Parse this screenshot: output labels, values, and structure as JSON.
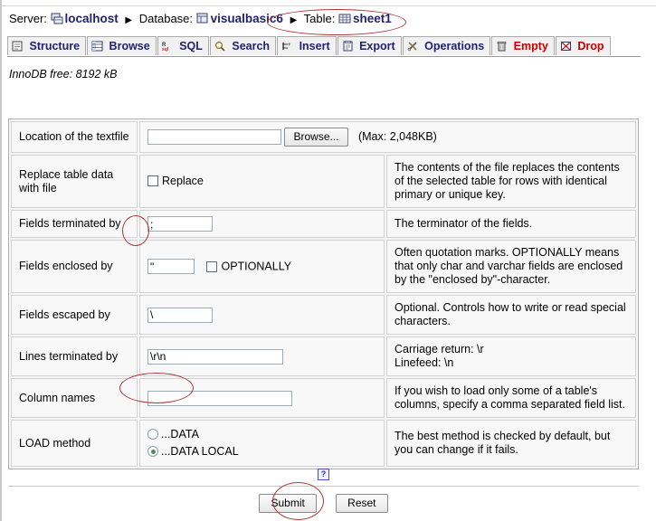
{
  "breadcrumb": {
    "server_label": "Server:",
    "server_value": "localhost",
    "database_label": "Database:",
    "database_value": "visualbasic6",
    "table_label": "Table:",
    "table_value": "sheet1",
    "separator": "▶"
  },
  "tabs": [
    {
      "label": "Structure",
      "icon": "structure-icon",
      "danger": false
    },
    {
      "label": "Browse",
      "icon": "browse-icon",
      "danger": false
    },
    {
      "label": "SQL",
      "icon": "sql-icon",
      "danger": false
    },
    {
      "label": "Search",
      "icon": "magnifier-icon",
      "danger": false
    },
    {
      "label": "Insert",
      "icon": "insert-icon",
      "danger": false
    },
    {
      "label": "Export",
      "icon": "export-icon",
      "danger": false
    },
    {
      "label": "Operations",
      "icon": "tools-icon",
      "danger": false
    },
    {
      "label": "Empty",
      "icon": "trash-icon",
      "danger": true
    },
    {
      "label": "Drop",
      "icon": "drop-icon",
      "danger": true
    }
  ],
  "status": {
    "innodb_free": "InnoDB free: 8192 kB"
  },
  "form": {
    "rows": [
      {
        "label": "Location of the textfile",
        "field_value": "",
        "browse_label": "Browse...",
        "max_note": "(Max: 2,048KB)",
        "desc": ""
      },
      {
        "label": "Replace table data with file",
        "checkbox_label": "Replace",
        "checked": false,
        "desc": "The contents of the file replaces the contents of the selected table for rows with identical primary or unique key."
      },
      {
        "label": "Fields terminated by",
        "field_value": ";",
        "desc": "The terminator of the fields."
      },
      {
        "label": "Fields enclosed by",
        "field_value": "\"",
        "checkbox_label": "OPTIONALLY",
        "checked": false,
        "desc": "Often quotation marks. OPTIONALLY means that only char and varchar fields are enclosed by the \"enclosed by\"-character."
      },
      {
        "label": "Fields escaped by",
        "field_value": "\\",
        "desc": "Optional. Controls how to write or read special characters."
      },
      {
        "label": "Lines terminated by",
        "field_value": "\\r\\n",
        "desc_line1": "Carriage return: \\r",
        "desc_line2": "Linefeed: \\n"
      },
      {
        "label": "Column names",
        "field_value": "",
        "desc": "If you wish to load only some of a table's columns, specify a comma separated field list."
      },
      {
        "label": "LOAD method",
        "radio1_label": "...DATA",
        "radio1_selected": false,
        "radio2_label": "...DATA LOCAL",
        "radio2_selected": true,
        "desc": "The best method is checked by default, but you can change if it fails."
      }
    ]
  },
  "footer": {
    "help_icon_label": "?",
    "submit_label": "Submit",
    "reset_label": "Reset"
  },
  "colors": {
    "link_blue": "#222270",
    "danger_red": "#cc0000",
    "annotation_red": "#b03535",
    "panel_bg": "#f6f6f6"
  }
}
